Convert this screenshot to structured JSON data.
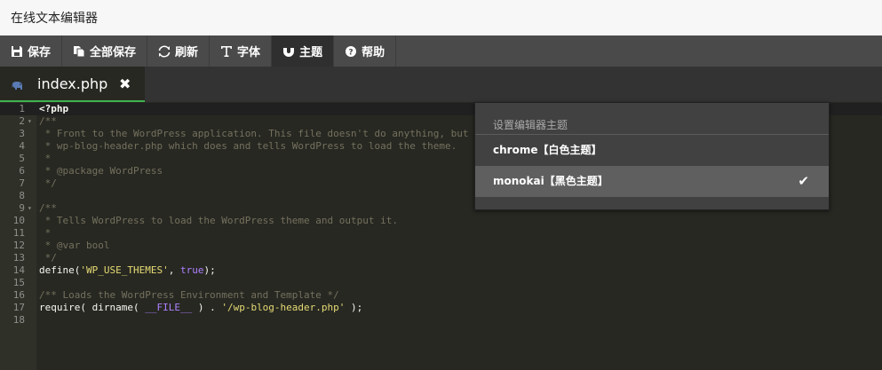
{
  "app": {
    "title": "在线文本编辑器"
  },
  "toolbar": {
    "buttons": [
      {
        "icon": "save-icon",
        "label": "保存"
      },
      {
        "icon": "copy-icon",
        "label": "全部保存"
      },
      {
        "icon": "refresh-icon",
        "label": "刷新"
      },
      {
        "icon": "font-icon",
        "label": "字体"
      },
      {
        "icon": "magnet-icon",
        "label": "主题",
        "active": true
      },
      {
        "icon": "help-icon",
        "label": "帮助"
      }
    ]
  },
  "tab": {
    "icon": "php-elephant-icon",
    "label": "index.php",
    "close": "✖"
  },
  "theme_menu": {
    "header": "设置编辑器主题",
    "items": [
      {
        "label": "chrome【白色主题】",
        "selected": false
      },
      {
        "label": "monokai【黑色主题】",
        "selected": true,
        "check": "✔"
      }
    ]
  },
  "editor": {
    "line_numbers": [
      "1",
      "2",
      "3",
      "4",
      "5",
      "6",
      "7",
      "8",
      "9",
      "10",
      "11",
      "12",
      "13",
      "14",
      "15",
      "16",
      "17",
      "18"
    ],
    "lines": [
      [
        {
          "t": "<?php",
          "c": "c-plain c-bold"
        }
      ],
      [
        {
          "t": "/**",
          "c": "c-comment"
        }
      ],
      [
        {
          "t": " * Front to the WordPress application. This file doesn't do anything, but",
          "c": "c-comment"
        }
      ],
      [
        {
          "t": " * wp-blog-header.php which does and tells WordPress to load the theme.",
          "c": "c-comment"
        }
      ],
      [
        {
          "t": " *",
          "c": "c-comment"
        }
      ],
      [
        {
          "t": " * @package WordPress",
          "c": "c-comment"
        }
      ],
      [
        {
          "t": " */",
          "c": "c-comment"
        }
      ],
      [],
      [
        {
          "t": "/**",
          "c": "c-comment"
        }
      ],
      [
        {
          "t": " * Tells WordPress to load the WordPress theme and output it.",
          "c": "c-comment"
        }
      ],
      [
        {
          "t": " *",
          "c": "c-comment"
        }
      ],
      [
        {
          "t": " * @var bool",
          "c": "c-comment"
        }
      ],
      [
        {
          "t": " */",
          "c": "c-comment"
        }
      ],
      [
        {
          "t": "define",
          "c": "c-plain"
        },
        {
          "t": "(",
          "c": "c-plain"
        },
        {
          "t": "'WP_USE_THEMES'",
          "c": "c-str"
        },
        {
          "t": ", ",
          "c": "c-plain"
        },
        {
          "t": "true",
          "c": "c-const"
        },
        {
          "t": ");",
          "c": "c-plain"
        }
      ],
      [],
      [
        {
          "t": "/** Loads the WordPress Environment and Template */",
          "c": "c-comment"
        }
      ],
      [
        {
          "t": "require",
          "c": "c-plain"
        },
        {
          "t": "( ",
          "c": "c-plain"
        },
        {
          "t": "dirname",
          "c": "c-plain"
        },
        {
          "t": "( ",
          "c": "c-plain"
        },
        {
          "t": "__FILE__",
          "c": "c-const"
        },
        {
          "t": " ) . ",
          "c": "c-plain"
        },
        {
          "t": "'/wp-blog-header.php'",
          "c": "c-str"
        },
        {
          "t": " );",
          "c": "c-plain"
        }
      ],
      []
    ],
    "fold_marker": "▾"
  }
}
